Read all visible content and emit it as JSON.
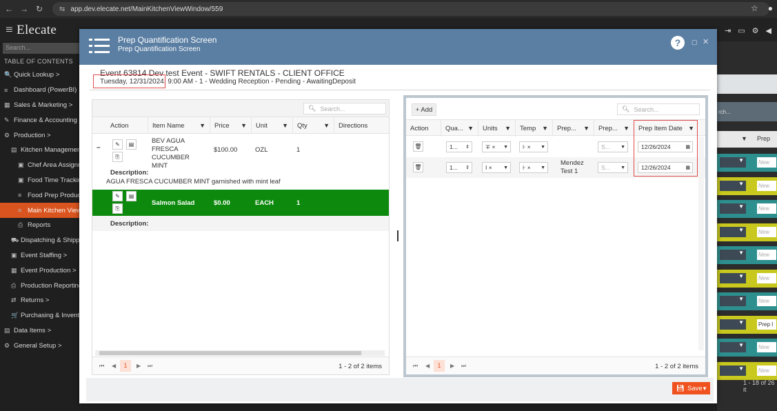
{
  "browser": {
    "url": "app.dev.elecate.net/MainKitchenViewWindow/559"
  },
  "app": {
    "logo": "≡ Elecate",
    "search_placeholder": "Search...",
    "toc_label": "TABLE OF CONTENTS"
  },
  "sidebar": {
    "items": [
      {
        "label": "Quick Lookup  >",
        "icon": "🔍",
        "level": 0
      },
      {
        "label": "Dashboard (PowerBI)",
        "icon": "≡",
        "level": 0
      },
      {
        "label": "Sales & Marketing  >",
        "icon": "▦",
        "level": 0
      },
      {
        "label": "Finance & Accounting",
        "icon": "✎",
        "level": 0
      },
      {
        "label": "Production  >",
        "icon": "⚙",
        "level": 0
      },
      {
        "label": "Kitchen Management",
        "icon": "▤",
        "level": 1
      },
      {
        "label": "Chef Area Assignm",
        "icon": "▣",
        "level": 2
      },
      {
        "label": "Food Time Tracking",
        "icon": "▣",
        "level": 2
      },
      {
        "label": "Food Prep Producti",
        "icon": "≡",
        "level": 2
      },
      {
        "label": "Main Kitchen View",
        "icon": "≡",
        "level": 2,
        "active": true
      },
      {
        "label": "Reports",
        "icon": "⎙",
        "level": 2
      },
      {
        "label": "Dispatching & Shipp",
        "icon": "⛟",
        "level": 1
      },
      {
        "label": "Event Staffing  >",
        "icon": "▣",
        "level": 1
      },
      {
        "label": "Event Production  >",
        "icon": "▦",
        "level": 1
      },
      {
        "label": "Production Reporting",
        "icon": "⎙",
        "level": 1
      },
      {
        "label": "Returns  >",
        "icon": "⇄",
        "level": 1
      },
      {
        "label": "Purchasing & Invent.",
        "icon": "🛒",
        "level": 1
      },
      {
        "label": "Data Items  >",
        "icon": "▤",
        "level": 0
      },
      {
        "label": "General Setup  >",
        "icon": "⚙",
        "level": 0
      }
    ]
  },
  "modal": {
    "title": "Prep Quantification Screen",
    "subtitle": "Prep Quantification Screen",
    "help": "?",
    "event_title": "Event 63814 Dev test Event - SWIFT RENTALS - CLIENT OFFICE",
    "event_date": "Tuesday, 12/31/2024, ",
    "event_details": "9:00 AM - 1 - Wedding Reception - Pending - AwaitingDeposit",
    "save_label": "Save"
  },
  "left_grid": {
    "search_placeholder": "Search...",
    "columns": [
      "Action",
      "Item Name",
      "Price",
      "Unit",
      "Qty",
      "Directions"
    ],
    "rows": [
      {
        "item": "BEV AGUA FRESCA CUCUMBER MINT",
        "price": "$100.00",
        "unit": "OZL",
        "qty": "1",
        "description_label": "Description:",
        "description": "AGUA FRESCA CUCUMBER MINT garnished with mint leaf",
        "expand": "−"
      },
      {
        "item": "Salmon Salad",
        "price": "$0.00",
        "unit": "EACH",
        "qty": "1",
        "description_label": "Description:",
        "description": "",
        "expand": "−"
      }
    ],
    "page": "1",
    "pager_info": "1 - 2 of 2 items"
  },
  "right_grid": {
    "add_label": "+ Add",
    "search_placeholder": "Search...",
    "columns": [
      "Action",
      "Qua...",
      "Units",
      "Temp",
      "Prep...",
      "Prep...",
      "Prep Item Date"
    ],
    "rows": [
      {
        "qty": "1...",
        "units": "∓ ×",
        "temp": "⊦ ×",
        "prep_by": "",
        "prep_status": "S...",
        "date": "12/26/2024"
      },
      {
        "qty": "1...",
        "units": "I ×",
        "temp": "⊦ ×",
        "prep_by": "Mendez Test 1",
        "prep_status": "S...",
        "date": "12/26/2024"
      }
    ],
    "page": "1",
    "pager_info": "1 - 2 of 2 items"
  },
  "background": {
    "prep_header": "Prep",
    "search": "rch...",
    "new_label": "New",
    "prep_i": "Prep I",
    "pager_info": "1 - 18 of 26 it"
  },
  "colors": {
    "accent": "#d9541e",
    "modal_header": "#5b7fa3",
    "selected_row": "#0d8a0d",
    "save": "#f0521f"
  }
}
